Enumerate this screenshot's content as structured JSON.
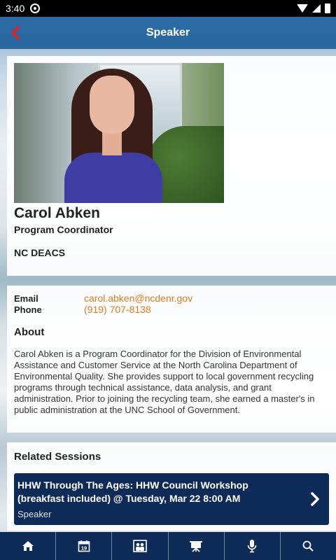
{
  "status": {
    "time": "3:40"
  },
  "header": {
    "title": "Speaker"
  },
  "speaker": {
    "name": "Carol Abken",
    "role": "Program Coordinator",
    "organization": "NC DEACS",
    "email_label": "Email",
    "email": "carol.abken@ncdenr.gov",
    "phone_label": "Phone",
    "phone": "(919) 707-8138",
    "about_heading": "About",
    "about": "Carol Abken is a Program Coordinator for the Division of Environmental Assistance and Customer Service at the North Carolina Department of Environmental Quality. She provides support to local government recycling programs through technical assistance, data analysis, and grant administration. Prior to joining the recycling team, she earned a master's in public administration at the UNC School of Government."
  },
  "related": {
    "heading": "Related Sessions",
    "sessions": [
      {
        "title": "HHW Through The Ages: HHW Council Workshop (breakfast included) @ Tuesday, Mar 22 8:00 AM",
        "role": "Speaker"
      }
    ]
  },
  "tabbar": {
    "items": [
      {
        "icon": "home-icon"
      },
      {
        "icon": "calendar-icon",
        "day": "19"
      },
      {
        "icon": "people-icon"
      },
      {
        "icon": "presentation-icon"
      },
      {
        "icon": "microphone-icon"
      },
      {
        "icon": "search-icon"
      }
    ]
  },
  "colors": {
    "appbar": "#2b6ba6",
    "accent": "#e07a1e",
    "navy": "#0e2b57",
    "back": "#d9262c"
  }
}
